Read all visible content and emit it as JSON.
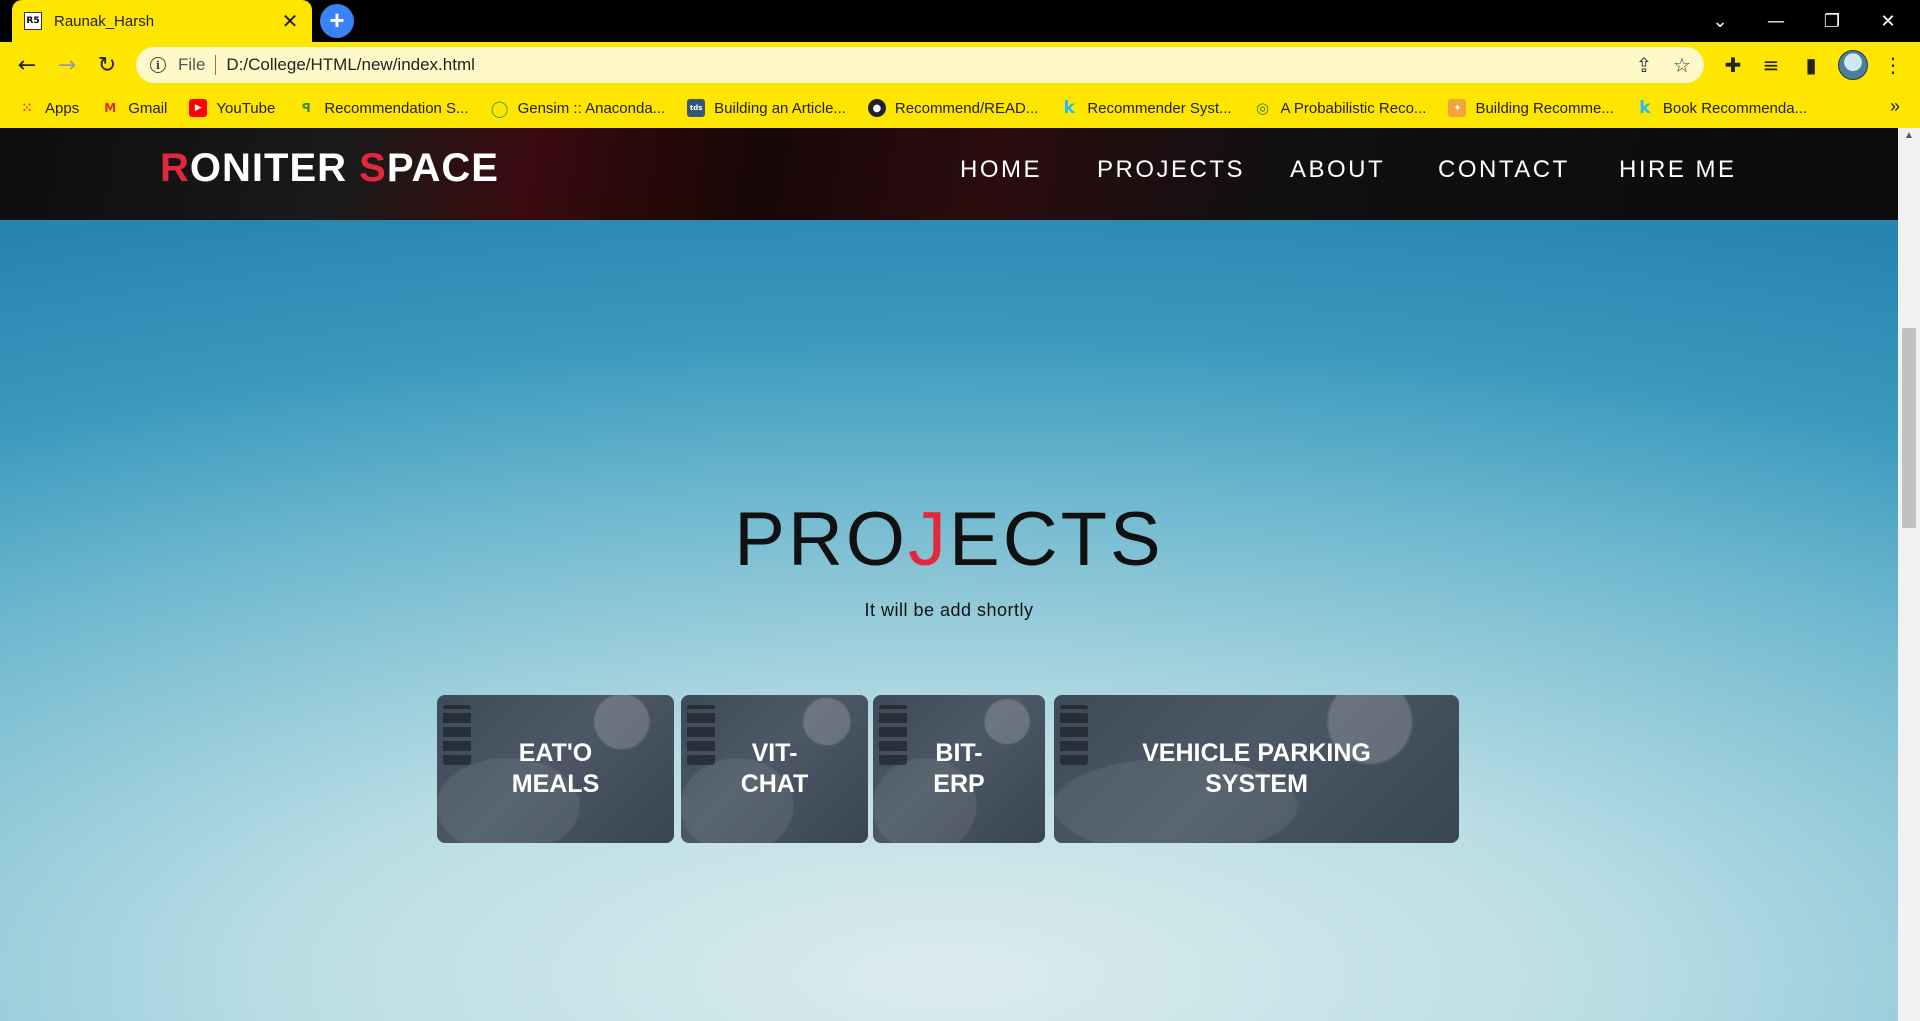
{
  "browser": {
    "tab": {
      "title": "Raunak_Harsh",
      "favicon": "R5"
    },
    "address": {
      "scheme": "File",
      "url": "D:/College/HTML/new/index.html"
    },
    "bookmarks": [
      {
        "label": "Apps",
        "icon": "apps-grid-icon"
      },
      {
        "label": "Gmail",
        "icon": "gmail-icon"
      },
      {
        "label": "YouTube",
        "icon": "youtube-icon"
      },
      {
        "label": "Recommendation S...",
        "icon": "gfg-icon"
      },
      {
        "label": "Gensim :: Anaconda...",
        "icon": "anaconda-icon"
      },
      {
        "label": "Building an Article...",
        "icon": "tds-icon"
      },
      {
        "label": "Recommend/READ...",
        "icon": "github-icon"
      },
      {
        "label": "Recommender Syst...",
        "icon": "kaggle-icon"
      },
      {
        "label": "A Probabilistic Reco...",
        "icon": "site-icon"
      },
      {
        "label": "Building Recomme...",
        "icon": "site-icon"
      },
      {
        "label": "Book Recommenda...",
        "icon": "kaggle-icon"
      }
    ]
  },
  "site": {
    "logo": {
      "r": "R",
      "oniter": "ONITER ",
      "s": "S",
      "pace": "PACE"
    },
    "nav": [
      "HOME",
      "PROJECTS",
      "ABOUT",
      "CONTACT",
      "HIRE ME"
    ],
    "projects": {
      "title_pre": "PRO",
      "title_accent": "J",
      "title_post": "ECTS",
      "subtitle": "It will be add shortly",
      "cards": [
        {
          "line1": "EAT'O",
          "line2": "MEALS"
        },
        {
          "line1": "VIT-",
          "line2": "CHAT"
        },
        {
          "line1": "BIT-",
          "line2": "ERP"
        },
        {
          "line1": "VEHICLE PARKING",
          "line2": "SYSTEM"
        }
      ]
    }
  },
  "colors": {
    "accent": "#e3283e",
    "browser_chrome": "#ffe600"
  }
}
